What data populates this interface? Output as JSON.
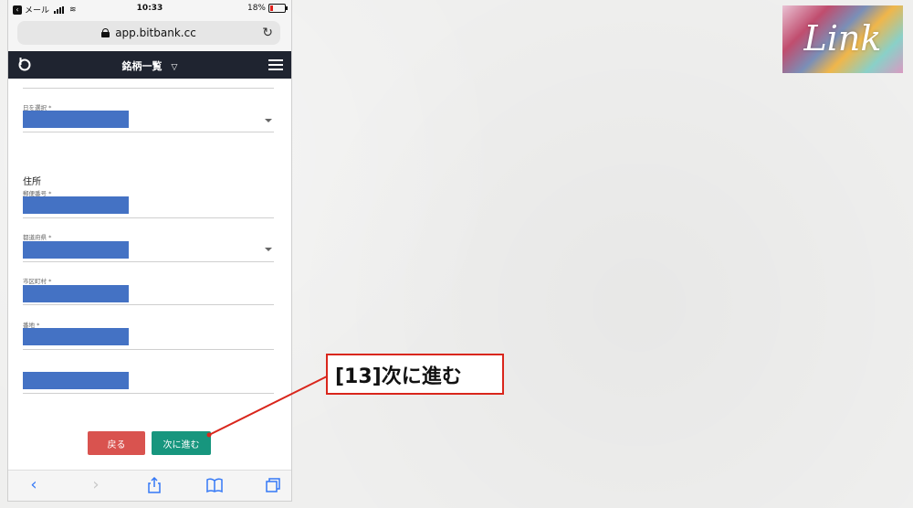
{
  "status": {
    "carrier": "メール",
    "time": "10:33",
    "battery": "18%",
    "battery_level": 0.18
  },
  "browser": {
    "url": "app.bitbank.cc"
  },
  "navbar": {
    "title": "銘柄一覧",
    "chevron": "⌄"
  },
  "form": {
    "day_label": "日を選択 *",
    "address_heading": "住所",
    "postal_label": "郵便番号 *",
    "prefecture_label": "都道府県 *",
    "city_label": "市区町村 *",
    "street_label": "番地 *"
  },
  "buttons": {
    "back": "戻る",
    "next": "次に進む"
  },
  "callout": {
    "text": "[13]次に進む",
    "color": "#d9261c"
  },
  "brand": {
    "logo_text": "Link"
  },
  "colors": {
    "redacted": "#4472c4",
    "navbar": "#1f2430",
    "back_button": "#d9534f",
    "next_button": "#17967e"
  }
}
